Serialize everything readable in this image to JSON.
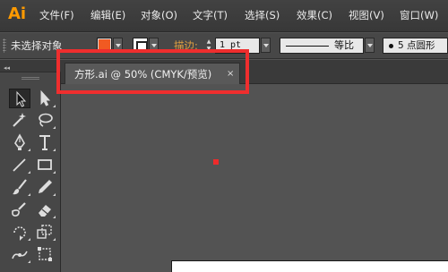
{
  "app": {
    "logo_text": "Ai",
    "logo_color": "#ff9a00"
  },
  "menu": {
    "items": [
      {
        "label": "文件(F)"
      },
      {
        "label": "编辑(E)"
      },
      {
        "label": "对象(O)"
      },
      {
        "label": "文字(T)"
      },
      {
        "label": "选择(S)"
      },
      {
        "label": "效果(C)"
      },
      {
        "label": "视图(V)"
      },
      {
        "label": "窗口(W)"
      }
    ]
  },
  "control_bar": {
    "selection_label": "未选择对象",
    "fill_color": "#f15a22",
    "stroke_color": "#ffffff",
    "stroke_label": "描边:",
    "stroke_weight": "1 pt",
    "profile_label": "等比",
    "brush_label": "5 点圆形"
  },
  "document_tab": {
    "title": "方形.ai @ 50% (CMYK/预览)",
    "close_symbol": "×"
  },
  "toolbox": {
    "collapse_symbol": "◂◂",
    "tools": [
      {
        "name": "selection-tool-icon",
        "active": true
      },
      {
        "name": "direct-selection-tool-icon",
        "active": false
      },
      {
        "name": "magic-wand-tool-icon",
        "active": false
      },
      {
        "name": "lasso-tool-icon",
        "active": false
      },
      {
        "name": "pen-tool-icon",
        "active": false
      },
      {
        "name": "type-tool-icon",
        "active": false
      },
      {
        "name": "line-segment-tool-icon",
        "active": false
      },
      {
        "name": "rectangle-tool-icon",
        "active": false
      },
      {
        "name": "paintbrush-tool-icon",
        "active": false
      },
      {
        "name": "pencil-tool-icon",
        "active": false
      },
      {
        "name": "blob-brush-tool-icon",
        "active": false
      },
      {
        "name": "eraser-tool-icon",
        "active": false
      },
      {
        "name": "rotate-tool-icon",
        "active": false
      },
      {
        "name": "scale-tool-icon",
        "active": false
      },
      {
        "name": "width-tool-icon",
        "active": false
      },
      {
        "name": "free-transform-tool-icon",
        "active": false
      }
    ]
  },
  "canvas": {
    "marker_color": "#ee2b2b",
    "highlight_color": "#ef2e2e"
  }
}
